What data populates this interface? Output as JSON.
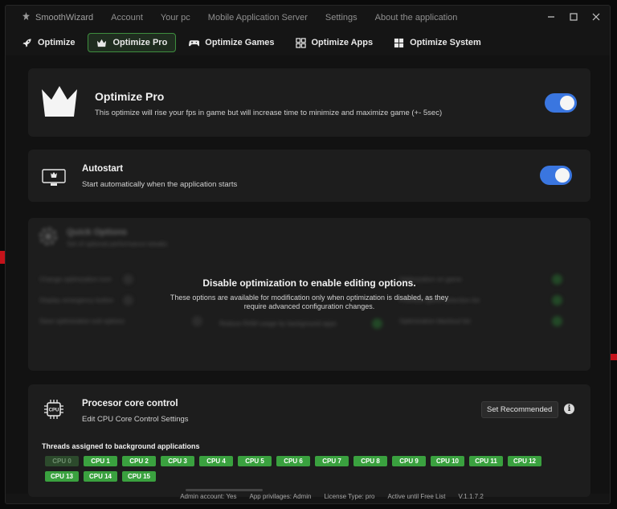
{
  "app": {
    "brand": "SmoothWizard"
  },
  "menu": [
    "Account",
    "Your pc",
    "Mobile Application Server",
    "Settings",
    "About the application"
  ],
  "tabs": [
    {
      "label": "Optimize",
      "icon": "rocket-icon"
    },
    {
      "label": "Optimize Pro",
      "icon": "crown-icon",
      "active": true
    },
    {
      "label": "Optimize Games",
      "icon": "gamepad-icon"
    },
    {
      "label": "Optimize Apps",
      "icon": "apps-grid-icon"
    },
    {
      "label": "Optimize System",
      "icon": "windows-icon"
    }
  ],
  "pro": {
    "title": "Optimize Pro",
    "desc": "This optimize will rise your fps in game but will increase time to minimize and maximize game (+- 5sec)",
    "enabled": true
  },
  "autostart": {
    "title": "Autostart",
    "desc": "Start automatically when the application starts",
    "enabled": true
  },
  "quick": {
    "title": "Quick Options",
    "subtitle": "Set of optional performance tweaks",
    "col1": [
      "Change optimization icon",
      "Display emergency button",
      "Save optimization exit options"
    ],
    "col2": [
      "",
      "",
      "Reduce RAM usage by background apps"
    ],
    "col3": [
      "Optimization on game",
      "Prioritize game detection list",
      "Optimization blackout list"
    ],
    "overlay_title": "Disable optimization to enable editing options.",
    "overlay_desc": "These options are available for modification only when optimization is disabled, as they require advanced configuration changes."
  },
  "cpu": {
    "title": "Procesor core control",
    "desc": "Edit CPU Core Control Settings",
    "button": "Set Recommended",
    "threads_label": "Threads assigned to background applications",
    "cores": [
      {
        "label": "CPU 0",
        "on": false
      },
      {
        "label": "CPU 1",
        "on": true
      },
      {
        "label": "CPU 2",
        "on": true
      },
      {
        "label": "CPU 3",
        "on": true
      },
      {
        "label": "CPU 4",
        "on": true
      },
      {
        "label": "CPU 5",
        "on": true
      },
      {
        "label": "CPU 6",
        "on": true
      },
      {
        "label": "CPU 7",
        "on": true
      },
      {
        "label": "CPU 8",
        "on": true
      },
      {
        "label": "CPU 9",
        "on": true
      },
      {
        "label": "CPU 10",
        "on": true
      },
      {
        "label": "CPU 11",
        "on": true
      },
      {
        "label": "CPU 12",
        "on": true
      },
      {
        "label": "CPU 13",
        "on": true
      },
      {
        "label": "CPU 14",
        "on": true
      },
      {
        "label": "CPU 15",
        "on": true
      }
    ]
  },
  "footer": {
    "admin": "Admin account: Yes",
    "privileges": "App privilages: Admin",
    "license": "License Type: pro",
    "active": "Active until Free List",
    "version": "V.1.1.7.2"
  },
  "colors": {
    "accent_green": "#3aa13f",
    "toggle_blue": "#3a76e0",
    "brand_red": "#c4121a"
  }
}
